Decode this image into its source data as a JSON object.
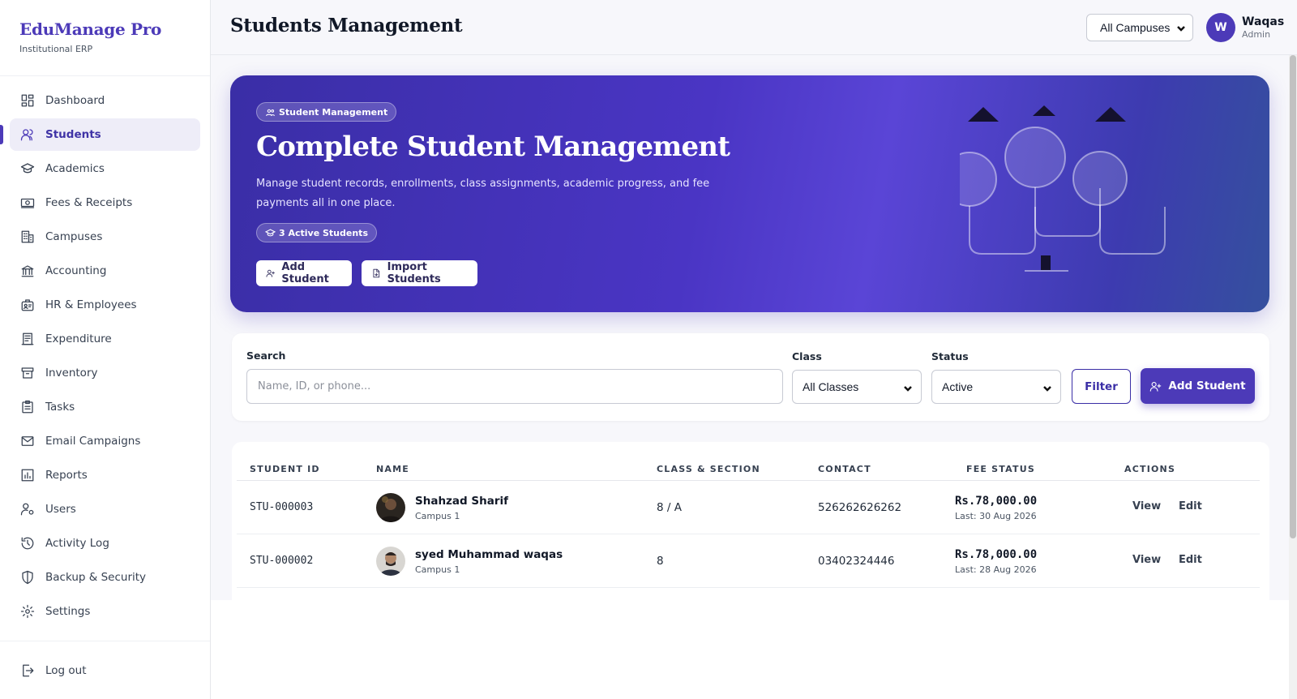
{
  "brand": {
    "name": "EduManage Pro",
    "subtitle": "Institutional ERP"
  },
  "sidebar": {
    "items": [
      {
        "label": "Dashboard",
        "icon": "grid-icon"
      },
      {
        "label": "Students",
        "icon": "users-icon",
        "active": true
      },
      {
        "label": "Academics",
        "icon": "graduation-cap-icon"
      },
      {
        "label": "Fees & Receipts",
        "icon": "cash-icon"
      },
      {
        "label": "Campuses",
        "icon": "building-icon"
      },
      {
        "label": "Accounting",
        "icon": "bank-icon"
      },
      {
        "label": "HR & Employees",
        "icon": "id-badge-icon"
      },
      {
        "label": "Expenditure",
        "icon": "receipt-icon"
      },
      {
        "label": "Inventory",
        "icon": "archive-icon"
      },
      {
        "label": "Tasks",
        "icon": "clipboard-icon"
      },
      {
        "label": "Email Campaigns",
        "icon": "mail-icon"
      },
      {
        "label": "Reports",
        "icon": "bar-chart-icon"
      },
      {
        "label": "Users",
        "icon": "user-gear-icon"
      },
      {
        "label": "Activity Log",
        "icon": "history-icon"
      },
      {
        "label": "Backup & Security",
        "icon": "shield-icon"
      },
      {
        "label": "Settings",
        "icon": "gear-icon"
      }
    ],
    "logout_label": "Log out"
  },
  "header": {
    "title": "Students Management",
    "campus_select": "All Campuses",
    "user": {
      "initial": "W",
      "name": "Waqas",
      "role": "Admin"
    }
  },
  "hero": {
    "chip": "Student Management",
    "title": "Complete Student Management",
    "description": "Manage student records, enrollments, class assignments, academic progress, and fee payments all in one place.",
    "badge": "3 Active Students",
    "add_button": "Add Student",
    "import_button": "Import Students"
  },
  "filters": {
    "search_label": "Search",
    "search_placeholder": "Name, ID, or phone...",
    "class_label": "Class",
    "class_value": "All Classes",
    "status_label": "Status",
    "status_value": "Active",
    "filter_button": "Filter",
    "add_button": "Add Student"
  },
  "table": {
    "headers": [
      "STUDENT ID",
      "NAME",
      "CLASS & SECTION",
      "CONTACT",
      "FEE STATUS",
      "ACTIONS"
    ],
    "rows": [
      {
        "id": "STU-000003",
        "name": "Shahzad Sharif",
        "campus": "Campus 1",
        "class": "8 / A",
        "contact": "526262626262",
        "fee": "Rs.78,000.00",
        "last": "Last: 30 Aug 2026",
        "view": "View",
        "edit": "Edit"
      },
      {
        "id": "STU-000002",
        "name": "syed Muhammad waqas",
        "campus": "Campus 1",
        "class": "8",
        "contact": "03402324446",
        "fee": "Rs.78,000.00",
        "last": "Last: 28 Aug 2026",
        "view": "View",
        "edit": "Edit"
      }
    ]
  },
  "colors": {
    "accent": "#4c3ab8",
    "hero_start": "#3a2ea6",
    "hero_end": "#35509e"
  }
}
